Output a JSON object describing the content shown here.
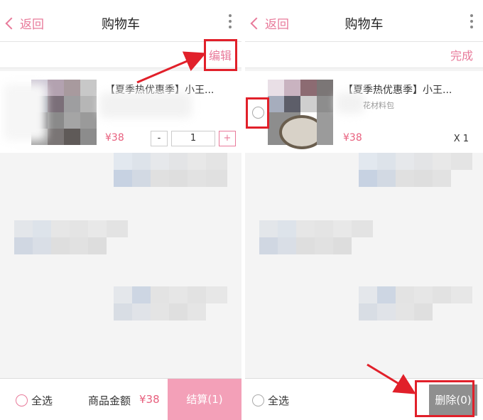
{
  "left_screen": {
    "header": {
      "back_label": "返回",
      "title": "购物车",
      "more_icon": "more-vertical-icon"
    },
    "edit_label": "编辑",
    "cart_item": {
      "title": "【夏季热优惠季】小王...",
      "price": "¥38",
      "quantity": "1",
      "decrement_label": "-",
      "increment_label": "+"
    },
    "footer": {
      "select_all_label": "全选",
      "total_label": "商品金额",
      "total_value": "¥38",
      "checkout_label": "结算(1)"
    }
  },
  "right_screen": {
    "header": {
      "back_label": "返回",
      "title": "购物车",
      "more_icon": "more-vertical-icon"
    },
    "done_label": "完成",
    "cart_item": {
      "title": "【夏季热优惠季】小王...",
      "subtitle": "花材料包",
      "price": "¥38",
      "quantity": "X 1"
    },
    "footer": {
      "select_all_label": "全选",
      "delete_label": "删除(0)"
    }
  },
  "colors": {
    "accent_pink": "#e87a9a",
    "price_pink": "#e8607e",
    "checkout_bg": "#f3a0b8",
    "delete_bg": "#8f8f8f",
    "annotation_red": "#e1202a"
  }
}
